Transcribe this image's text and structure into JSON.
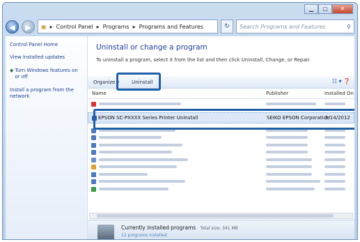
{
  "addressbar": {
    "crumb1": "Control Panel",
    "crumb2": "Programs",
    "crumb3": "Programs and Features",
    "search_placeholder": "Search Programs and Features"
  },
  "sidebar": {
    "home": "Control Panel Home",
    "updates": "View installed updates",
    "features": "Turn Windows features on or off",
    "network": "Install a program from the network"
  },
  "main": {
    "title": "Uninstall or change a program",
    "description": "To uninstall a program, select it from the list and then click Uninstall, Change, or Repair."
  },
  "toolbar": {
    "organize": "Organize ▾",
    "uninstall": "Uninstall",
    "views": "☷ ▾  ❓"
  },
  "columns": {
    "name": "Name",
    "publisher": "Publisher",
    "installed_on": "Installed On"
  },
  "selected_row": {
    "name": "EPSON SC-PXXXX Series Printer Uninstall",
    "publisher": "SEIKO EPSON Corporation",
    "date": "5/14/2012"
  },
  "status": {
    "title": "Currently installed programs",
    "total_size": "Total size: 341 MB",
    "count": "12 programs installed"
  },
  "colors": {
    "highlight": "#1f5fa8",
    "link": "#1e3f9a"
  }
}
